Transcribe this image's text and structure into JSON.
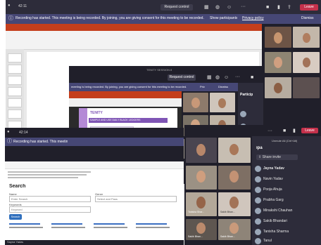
{
  "back_window": {
    "time": "42:11",
    "request_control": "Request control",
    "recording_banner": "Recording has started.  This meeting is being recorded. By joining, you are giving consent for this meeting to be recorded.",
    "show_participants": "Show participants",
    "privacy_policy": "Privacy policy",
    "dismiss": "Dismiss",
    "leave": "Leave"
  },
  "middle_window": {
    "title": "TENITY SESSION 8",
    "request_control": "Request control",
    "recording_banner": "meeting is being recorded. By joining, you are giving consent for this meeting to be recorded.",
    "privacy_link": "Priv",
    "dismiss": "Dismiss",
    "participants_heading": "Particip",
    "tile_name": "Sakib Bhan...",
    "slide_header": "TENITY",
    "slide_banner": "SAMPLE AND USE DAILY BLACK LEDGERS"
  },
  "front_left_window": {
    "time": "42:14",
    "recording_banner": "Recording has started.  This meetin",
    "search_heading": "Search",
    "field_labels": [
      "Name",
      "Genre",
      "Keywords"
    ],
    "field_values": [
      "Enter Search",
      "Select and Pass",
      "Keyword"
    ],
    "search_button": "Search"
  },
  "front_right_window": {
    "leave": "Leave",
    "share_invite": "Share invite",
    "dropdown": "Unmute All (Ctrl+Alt)",
    "section_heading": "ipa",
    "participants": [
      "Jayna Yadav",
      "Navin Yadav",
      "Pooja Ahuja",
      "Prabha Garg",
      "Minakshi Chauhan",
      "Sakib Bhandari",
      "Tanisha Sharma",
      "Tanul"
    ],
    "tile_names": [
      "Tanisha Shar...",
      "Sakib Bhan...",
      "Sakib Bhan...",
      "Sakib Bhan..."
    ],
    "bottom_left": "Sayna Yadav"
  },
  "colors": {
    "teams_dark": "#201f2a",
    "teams_bar": "#2d2c3a",
    "banner_purple": "#464775",
    "leave_red": "#c4314b",
    "ppt_orange": "#c43e1c",
    "slide_purple": "#7f55b5"
  }
}
